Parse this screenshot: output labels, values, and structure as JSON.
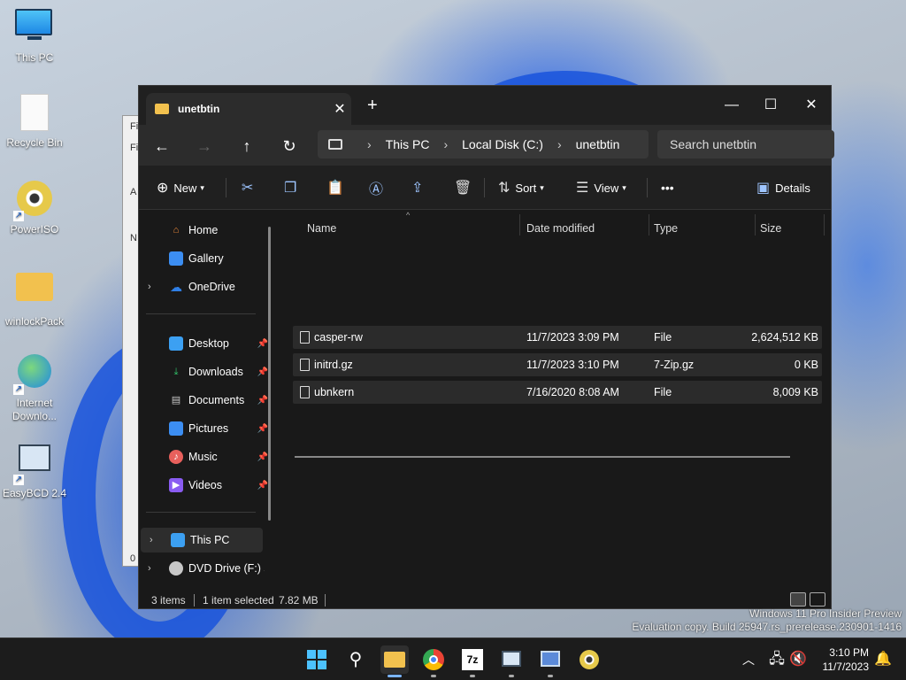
{
  "desktop": {
    "icons": [
      {
        "label": "This PC"
      },
      {
        "label": "Recycle Bin"
      },
      {
        "label": "PowerISO"
      },
      {
        "label": "winlockPack"
      },
      {
        "label": "Internet Downlo..."
      },
      {
        "label": "EasyBCD 2.4"
      }
    ]
  },
  "bg_window": {
    "fragments": [
      "Fi",
      "A",
      "N",
      "0 /"
    ]
  },
  "explorer": {
    "tab_title": "unetbtin",
    "new_tab": "+",
    "address": {
      "segments": [
        "This PC",
        "Local Disk (C:)",
        "unetbtin"
      ]
    },
    "search_placeholder": "Search unetbtin",
    "commands": {
      "new": "New",
      "sort": "Sort",
      "view": "View",
      "more": "•••",
      "details": "Details"
    },
    "sidebar": {
      "items": [
        {
          "label": "Home",
          "color": "#f28b3c"
        },
        {
          "label": "Gallery",
          "color": "#3c8ef2"
        },
        {
          "label": "OneDrive",
          "color": "#2f7fe6"
        },
        {
          "label": "Desktop",
          "color": "#3ca0f2"
        },
        {
          "label": "Downloads",
          "color": "#31c46a"
        },
        {
          "label": "Documents",
          "color": "#c8c8c8"
        },
        {
          "label": "Pictures",
          "color": "#3c8ef2"
        },
        {
          "label": "Music",
          "color": "#e8605c"
        },
        {
          "label": "Videos",
          "color": "#8a5cf2"
        },
        {
          "label": "This PC",
          "color": "#3ca0f2"
        },
        {
          "label": "DVD Drive (F:) sl",
          "color": "#c8c8c8"
        }
      ]
    },
    "columns": [
      "Name",
      "Date modified",
      "Type",
      "Size"
    ],
    "files": [
      {
        "name": "casper-rw",
        "date": "11/7/2023 3:09 PM",
        "type": "File",
        "size": "2,624,512 KB"
      },
      {
        "name": "initrd.gz",
        "date": "11/7/2023 3:10 PM",
        "type": "7-Zip.gz",
        "size": "0 KB"
      },
      {
        "name": "ubnkern",
        "date": "7/16/2020 8:08 AM",
        "type": "File",
        "size": "8,009 KB"
      }
    ],
    "status": {
      "items": "3 items",
      "selected": "1 item selected",
      "size": "7.82 MB"
    }
  },
  "watermark": {
    "line1": "Windows 11 Pro Insider Preview",
    "line2": "Evaluation copy. Build 25947.rs_prerelease.230901-1416"
  },
  "taskbar": {
    "time": "3:10 PM",
    "date": "11/7/2023",
    "apps": [
      "start-icon",
      "search-icon",
      "file-explorer-icon",
      "chrome-icon",
      "7zip-icon",
      "easybcd-icon",
      "network-setup-icon",
      "poweriso-icon"
    ]
  },
  "colors": {
    "folder": "#f2c14e",
    "accent": "#7ab4ff"
  }
}
